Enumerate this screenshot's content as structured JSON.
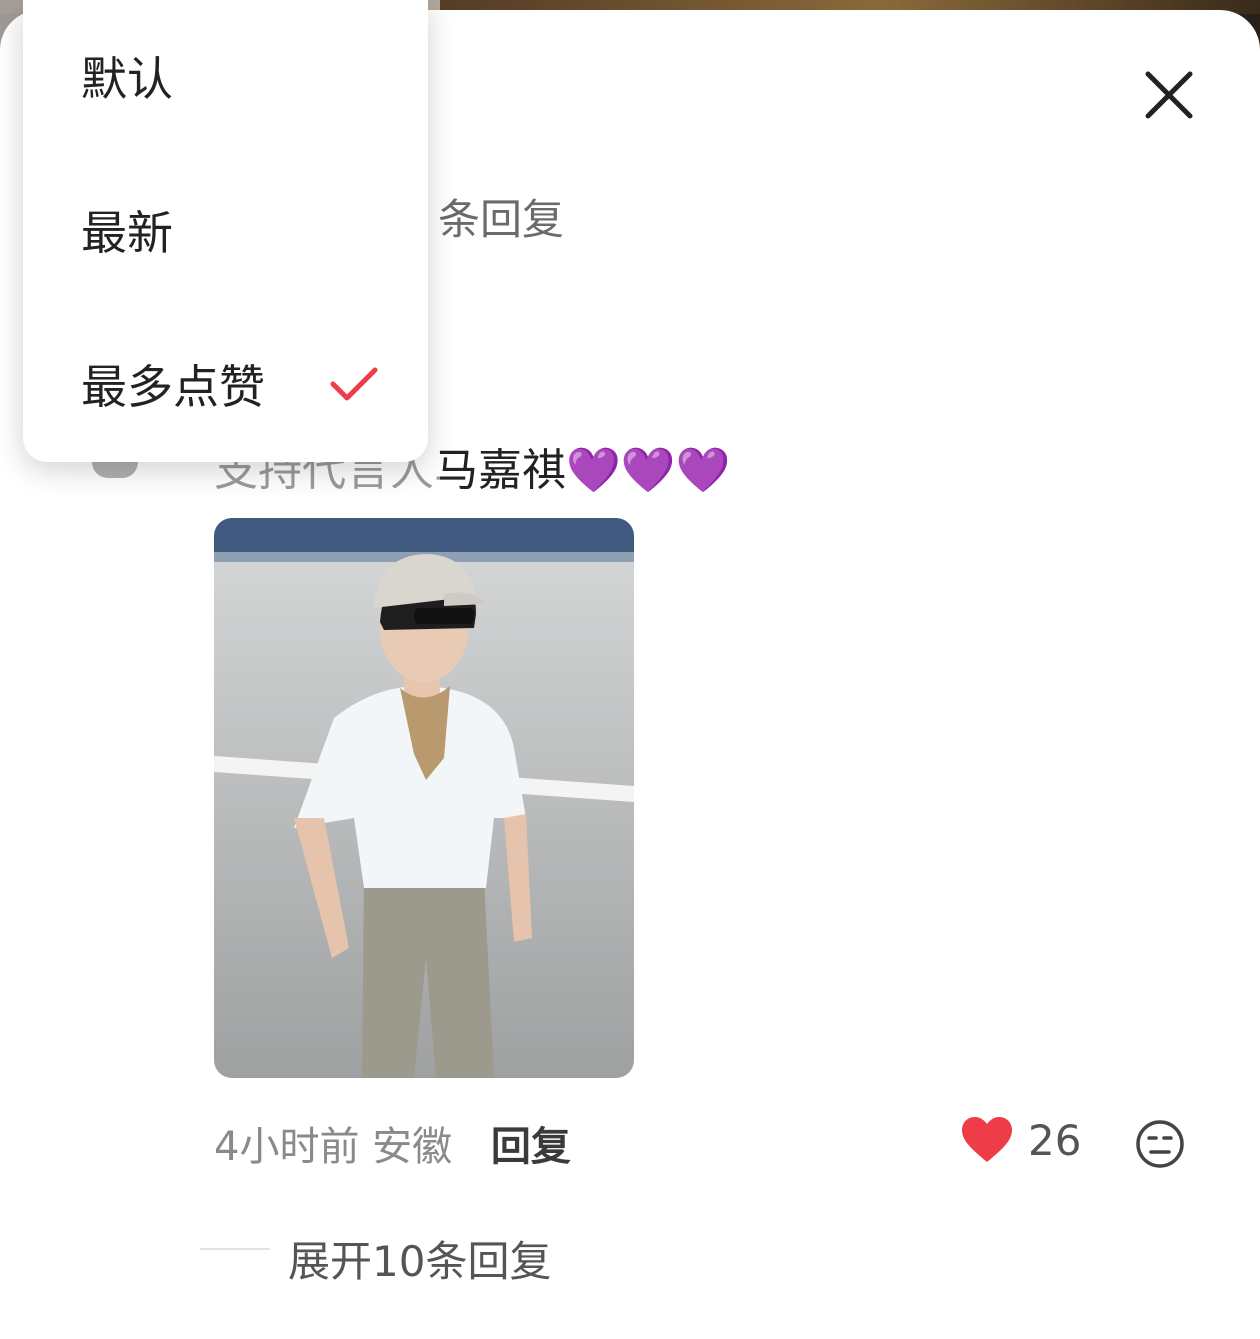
{
  "header": {
    "reply_count_suffix": "条回复",
    "close_icon": "close-icon"
  },
  "comment": {
    "text": "支持代言人马嘉祺💜💜💜",
    "time": "4小时前",
    "location": "安徽",
    "reply_label": "回复",
    "like_count": "26",
    "like_icon": "heart-icon",
    "like_color": "#ee3d48",
    "emoji_icon": "emoji-face-icon",
    "expand_label": "展开10条回复"
  },
  "sort_menu": {
    "items": [
      {
        "label": "默认",
        "selected": false
      },
      {
        "label": "最新",
        "selected": false
      },
      {
        "label": "最多点赞",
        "selected": true
      }
    ],
    "check_color": "#ee3d48"
  }
}
